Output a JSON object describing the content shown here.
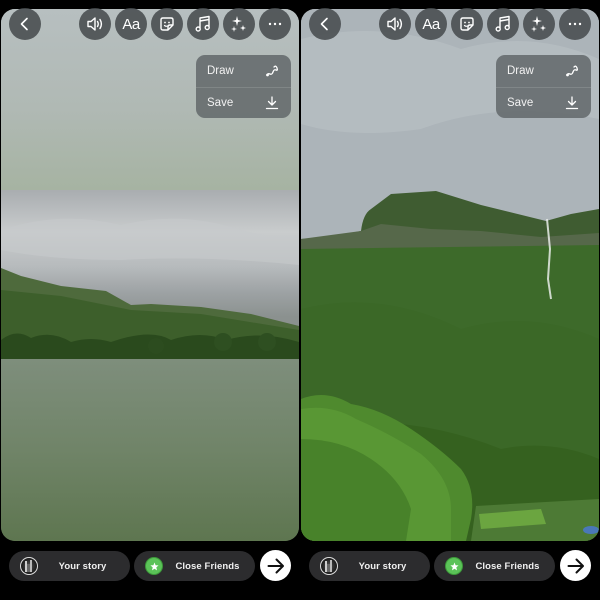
{
  "panels": [
    {
      "id": "left",
      "photo_description": "letterboxed landscape of green hills under cloudy sky",
      "toolbar": {
        "back_icon": "chevron-left-icon",
        "buttons": [
          {
            "name": "sound",
            "icon": "speaker-icon"
          },
          {
            "name": "text",
            "icon": "text-icon",
            "label": "Aa"
          },
          {
            "name": "sticker",
            "icon": "sticker-icon"
          },
          {
            "name": "music",
            "icon": "music-note-icon"
          },
          {
            "name": "effects",
            "icon": "sparkles-icon"
          },
          {
            "name": "more",
            "icon": "ellipsis-icon"
          }
        ]
      },
      "menu": {
        "items": [
          {
            "label": "Draw",
            "icon": "squiggle-draw-icon"
          },
          {
            "label": "Save",
            "icon": "download-icon"
          }
        ]
      },
      "bottom_bar": {
        "your_story_label": "Your story",
        "close_friends_label": "Close Friends",
        "next_icon": "arrow-right-icon"
      }
    },
    {
      "id": "right",
      "photo_description": "full-screen mountain with waterfall and green trees",
      "toolbar": {
        "back_icon": "chevron-left-icon",
        "buttons": [
          {
            "name": "sound",
            "icon": "speaker-icon"
          },
          {
            "name": "text",
            "icon": "text-icon",
            "label": "Aa"
          },
          {
            "name": "sticker",
            "icon": "sticker-icon"
          },
          {
            "name": "music",
            "icon": "music-note-icon"
          },
          {
            "name": "effects",
            "icon": "sparkles-icon"
          },
          {
            "name": "more",
            "icon": "ellipsis-icon"
          }
        ]
      },
      "menu": {
        "items": [
          {
            "label": "Draw",
            "icon": "squiggle-draw-icon"
          },
          {
            "label": "Save",
            "icon": "download-icon"
          }
        ]
      },
      "bottom_bar": {
        "your_story_label": "Your story",
        "close_friends_label": "Close Friends",
        "next_icon": "arrow-right-icon"
      }
    }
  ],
  "colors": {
    "background": "#000000",
    "control_fill": "#484c4e",
    "pill_fill": "#2c2c2e",
    "close_friends_green": "#5bc358",
    "next_button": "#ffffff"
  }
}
